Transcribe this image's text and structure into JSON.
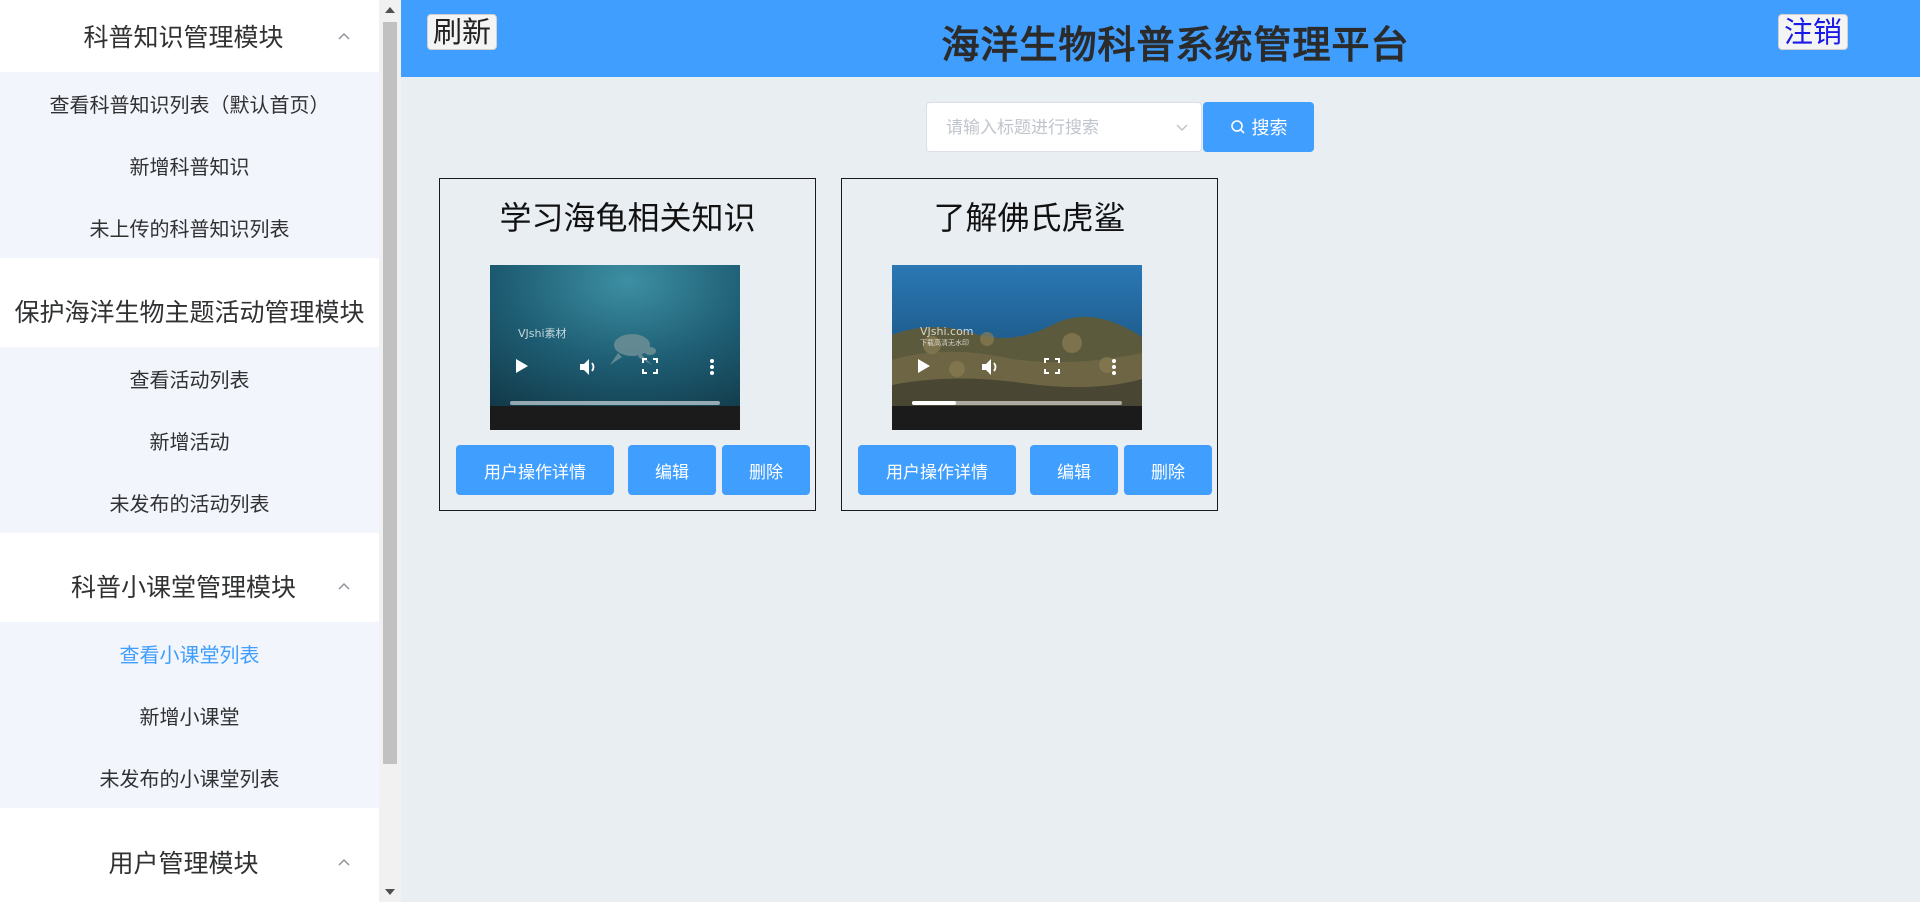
{
  "app": {
    "title": "海洋生物科普系统管理平台",
    "refresh_label": "刷新",
    "logout_label": "注销"
  },
  "sidebar": {
    "groups": [
      {
        "title": "科普知识管理模块",
        "icon": "chevron-up-icon",
        "items": [
          {
            "label": "查看科普知识列表（默认首页）"
          },
          {
            "label": "新增科普知识"
          },
          {
            "label": "未上传的科普知识列表"
          }
        ]
      },
      {
        "title": "保护海洋生物主题活动管理模块",
        "items": [
          {
            "label": "查看活动列表"
          },
          {
            "label": "新增活动"
          },
          {
            "label": "未发布的活动列表"
          }
        ]
      },
      {
        "title": "科普小课堂管理模块",
        "icon": "chevron-up-icon",
        "items": [
          {
            "label": "查看小课堂列表",
            "active": true
          },
          {
            "label": "新增小课堂"
          },
          {
            "label": "未发布的小课堂列表"
          }
        ]
      },
      {
        "title": "用户管理模块",
        "icon": "chevron-up-icon",
        "items": []
      }
    ]
  },
  "search": {
    "placeholder": "请输入标题进行搜索",
    "value": "",
    "button_label": "搜索",
    "button_icon": "search-icon"
  },
  "cards": [
    {
      "title": "学习海龟相关知识",
      "video_watermark": "VJshi素材",
      "video_progress": 0,
      "buttons": {
        "details": "用户操作详情",
        "edit": "编辑",
        "delete": "删除"
      }
    },
    {
      "title": "了解佛氏虎鲨",
      "video_watermark": "VJshi.com",
      "video_watermark_sub": "下载高清无水印",
      "video_progress": 0.21,
      "buttons": {
        "details": "用户操作详情",
        "edit": "编辑",
        "delete": "删除"
      }
    }
  ],
  "colors": {
    "accent": "#409eff",
    "sidebar_active": "#409eff",
    "background": "#e9eef3",
    "submenu_bg": "#f2f5fb"
  }
}
